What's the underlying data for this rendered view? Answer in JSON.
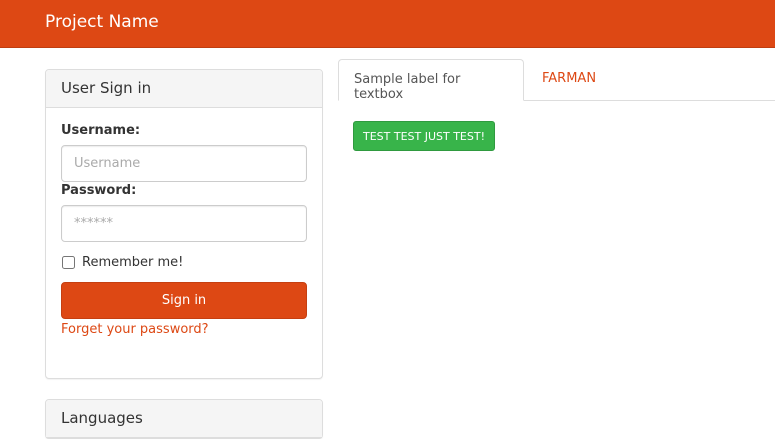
{
  "navbar": {
    "brand": "Project Name"
  },
  "signin_panel": {
    "title": "User Sign in",
    "username_label": "Username:",
    "username_placeholder": "Username",
    "password_label": "Password:",
    "password_placeholder": "******",
    "remember_label": "Remember me!",
    "signin_button": "Sign in",
    "forgot_link": "Forget your password?"
  },
  "languages_panel": {
    "title": "Languages"
  },
  "tabs": [
    {
      "label": "Sample label for textbox",
      "active": true
    },
    {
      "label": "FARMAN",
      "active": false
    }
  ],
  "content": {
    "test_button": "TEST TEST JUST TEST!"
  },
  "colors": {
    "brand": "#dd4814",
    "success": "#38b44a"
  }
}
